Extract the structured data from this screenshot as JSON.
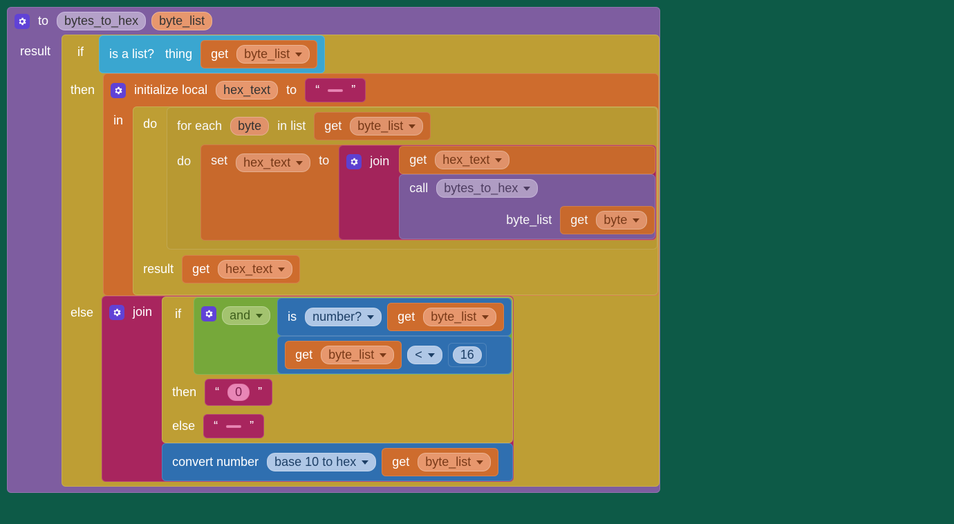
{
  "proc": {
    "to": "to",
    "name": "bytes_to_hex",
    "param": "byte_list",
    "result_label": "result"
  },
  "if1": {
    "if": "if",
    "then": "then",
    "else": "else"
  },
  "islist": {
    "label1": "is a list?",
    "label2": "thing",
    "get": "get",
    "var": "byte_list"
  },
  "initlocal": {
    "label": "initialize local",
    "var": "hex_text",
    "to": "to",
    "in": "in",
    "str_open": "“",
    "str_close": "”",
    "str_val": " "
  },
  "do_label": "do",
  "foreach": {
    "label1": "for each",
    "var": "byte",
    "label2": "in list",
    "do": "do",
    "get": "get",
    "list_var": "byte_list"
  },
  "set": {
    "label": "set",
    "var": "hex_text",
    "to": "to"
  },
  "join_label": "join",
  "get_hex": {
    "get": "get",
    "var": "hex_text"
  },
  "call": {
    "label": "call",
    "proc": "bytes_to_hex",
    "arg_name": "byte_list",
    "get": "get",
    "arg_var": "byte"
  },
  "result2": {
    "label": "result",
    "get": "get",
    "var": "hex_text"
  },
  "if2": {
    "if": "if",
    "and": "and",
    "isnum_label": "is",
    "isnum_dd": "number?",
    "get": "get",
    "var": "byte_list",
    "lt": "<",
    "num": "16",
    "then": "then",
    "then_val": "0",
    "else": "else",
    "else_val": " ",
    "qo": "“",
    "qc": "”"
  },
  "conv": {
    "label": "convert number",
    "dd": "base 10 to hex",
    "get": "get",
    "var": "byte_list"
  }
}
